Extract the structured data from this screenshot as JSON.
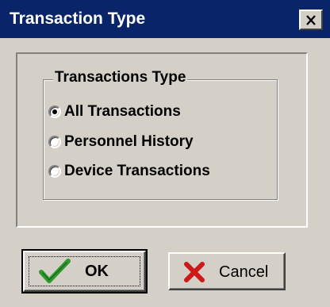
{
  "window": {
    "title": "Transaction Type",
    "close_glyph": "close-icon"
  },
  "group": {
    "label": "Transactions Type",
    "options": [
      {
        "label": "All Transactions",
        "selected": true
      },
      {
        "label": "Personnel History",
        "selected": false
      },
      {
        "label": "Device Transactions",
        "selected": false
      }
    ]
  },
  "buttons": {
    "ok": {
      "label": "OK",
      "icon": "checkmark-icon",
      "icon_color": "#2e9a2e"
    },
    "cancel": {
      "label": "Cancel",
      "icon": "x-mark-icon",
      "icon_color": "#cc1a1a"
    }
  },
  "colors": {
    "titlebar": "#0a246a",
    "face": "#d4d0c8"
  }
}
